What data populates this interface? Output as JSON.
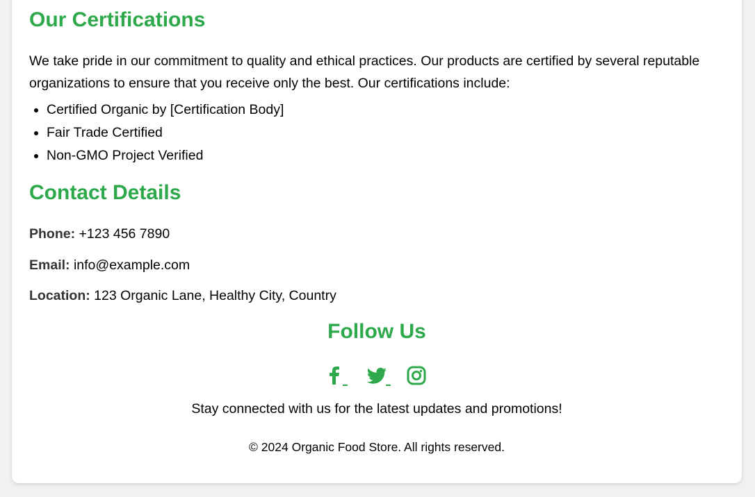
{
  "certifications": {
    "title": "Our Certifications",
    "intro": "We take pride in our commitment to quality and ethical practices. Our products are certified by several reputable organizations to ensure that you receive only the best. Our certifications include:",
    "items": [
      "Certified Organic by [Certification Body]",
      "Fair Trade Certified",
      "Non-GMO Project Verified"
    ]
  },
  "contact": {
    "title": "Contact Details",
    "phone_label": "Phone:",
    "phone_value": "+123 456 7890",
    "email_label": "Email:",
    "email_value": "info@example.com",
    "location_label": "Location:",
    "location_value": "123 Organic Lane, Healthy City, Country"
  },
  "follow": {
    "title": "Follow Us",
    "icons": [
      "facebook-icon",
      "twitter-icon",
      "instagram-icon"
    ],
    "tagline": "Stay connected with us for the latest updates and promotions!"
  },
  "footer": {
    "copyright": "© 2024 Organic Food Store. All rights reserved."
  },
  "colors": {
    "accent": "#2da84a",
    "page_background": "#f1f1f1",
    "card_background": "#ffffff"
  }
}
